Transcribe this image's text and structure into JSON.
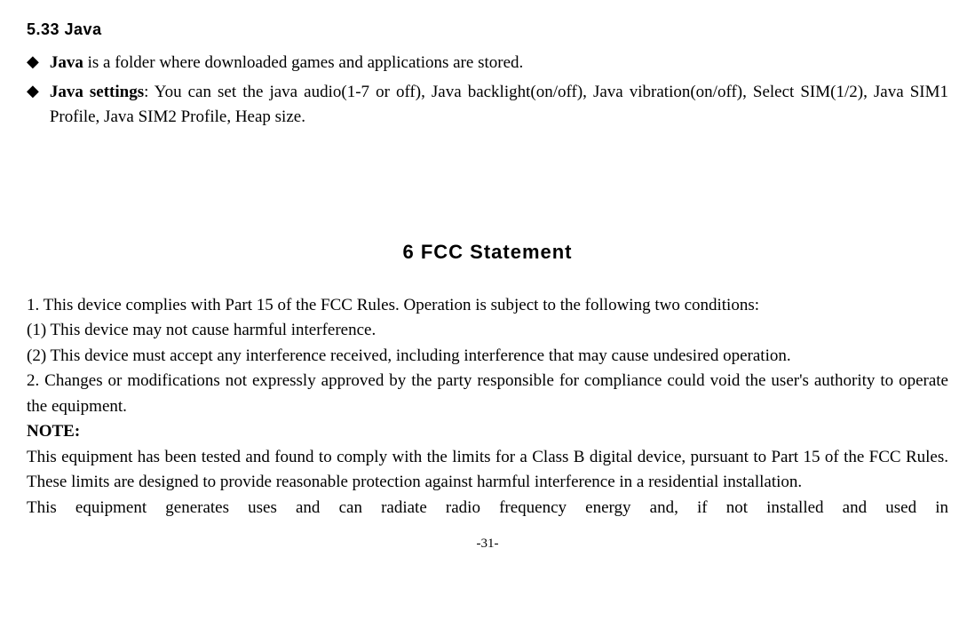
{
  "section_heading": "5.33  Java",
  "bullets": [
    {
      "bold": "Java",
      "text": " is a folder where downloaded games and applications are stored."
    },
    {
      "bold": "Java settings",
      "text": ": You can set the java audio(1-7 or off), Java backlight(on/off), Java vibration(on/off), Select SIM(1/2), Java SIM1 Profile, Java SIM2 Profile, Heap size."
    }
  ],
  "chapter_heading": "6  FCC Statement",
  "paragraphs": {
    "p1": "1. This device complies with Part 15 of the FCC Rules. Operation is subject to the following two conditions:",
    "p2": "(1) This device may not cause harmful interference.",
    "p3": "(2) This device must accept any interference received, including interference that may cause undesired operation.",
    "p4": "2. Changes or modifications not expressly approved by the party responsible for compliance could void the user's authority to operate the equipment.",
    "note_label": "NOTE:",
    "p5": "This equipment has been tested and found to comply with the limits for a Class B digital device, pursuant to Part 15 of the FCC Rules. These limits are designed to provide reasonable protection against harmful interference in a residential installation.",
    "p6": "This equipment generates uses and can radiate radio frequency energy and, if not installed and used in"
  },
  "page_number": "-31-"
}
